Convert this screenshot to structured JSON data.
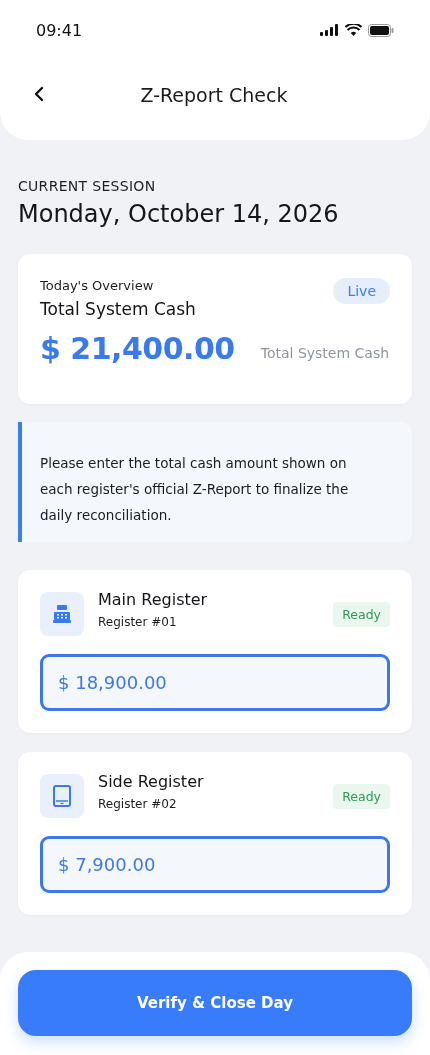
{
  "status_bar": {
    "time": "09:41"
  },
  "header": {
    "title": "Z-Report Check"
  },
  "session": {
    "label": "CURRENT SESSION",
    "date": "Monday, October 14, 2026"
  },
  "overview": {
    "eyebrow": "Today's Overview",
    "title": "Total System Cash",
    "badge": "Live",
    "amount": "$ 21,400.00",
    "caption": "Total System Cash"
  },
  "notice": "Please enter the total cash amount shown on each register's official Z-Report to finalize the daily reconciliation.",
  "registers": [
    {
      "kind": "register",
      "name": "Main Register",
      "number": "Register #01",
      "status": "Ready",
      "value": "$ 18,900.00"
    },
    {
      "kind": "tablet",
      "name": "Side Register",
      "number": "Register #02",
      "status": "Ready",
      "value": "$ 7,900.00"
    }
  ],
  "footer": {
    "button": "Verify & Close Day"
  }
}
